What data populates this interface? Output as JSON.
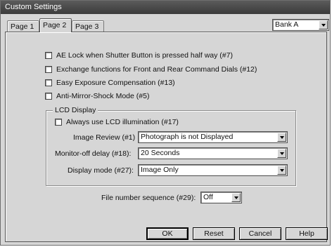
{
  "window": {
    "title": "Custom Settings"
  },
  "tabs": [
    {
      "label": "Page 1"
    },
    {
      "label": "Page 2"
    },
    {
      "label": "Page 3"
    }
  ],
  "bank": {
    "value": "Bank A"
  },
  "options": [
    {
      "label": "AE Lock when Shutter Button is pressed half way (#7)",
      "checked": false
    },
    {
      "label": "Exchange functions for Front and Rear Command Dials (#12)",
      "checked": false
    },
    {
      "label": "Easy Exposure Compensation (#13)",
      "checked": false
    },
    {
      "label": "Anti-Mirror-Shock Mode (#5)",
      "checked": false
    }
  ],
  "lcd": {
    "group_label": "LCD Display",
    "always_illumination": {
      "label": "Always use LCD illumination (#17)",
      "checked": false
    },
    "image_review": {
      "label": "Image Review (#1)",
      "value": "Photograph is not Displayed"
    },
    "monitor_off": {
      "label": "Monitor-off delay (#18):",
      "value": "20 Seconds"
    },
    "display_mode": {
      "label": "Display mode (#27):",
      "value": "Image Only"
    }
  },
  "file_number": {
    "label": "File number sequence (#29):",
    "value": "Off"
  },
  "buttons": {
    "ok": {
      "mnemonic": "O",
      "rest": "K"
    },
    "reset": {
      "mnemonic": "R",
      "rest": "eset"
    },
    "cancel": {
      "mnemonic": "C",
      "rest": "ancel"
    },
    "help": {
      "mnemonic": "H",
      "rest": "elp"
    }
  }
}
